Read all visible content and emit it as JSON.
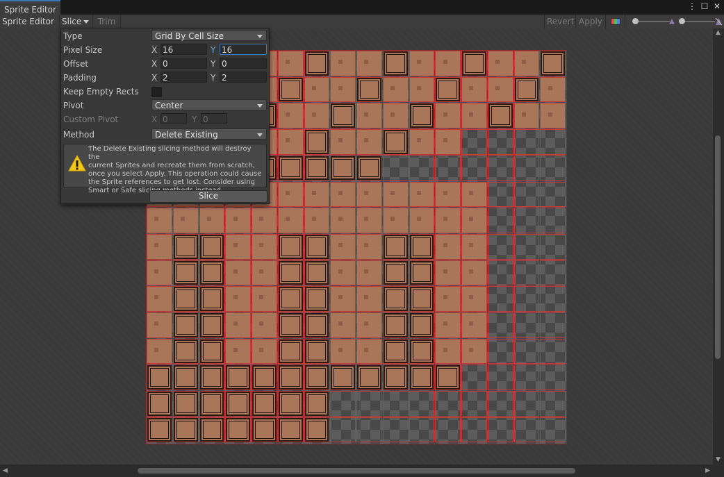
{
  "window": {
    "tab_title": "Sprite Editor"
  },
  "toolbar": {
    "mode_label": "Sprite Editor",
    "slice_label": "Slice",
    "trim_label": "Trim",
    "revert_label": "Revert",
    "apply_label": "Apply"
  },
  "slice_panel": {
    "type": {
      "label": "Type",
      "value": "Grid By Cell Size"
    },
    "pixel_size": {
      "label": "Pixel Size",
      "x": "16",
      "y": "16"
    },
    "offset": {
      "label": "Offset",
      "x": "0",
      "y": "0"
    },
    "padding": {
      "label": "Padding",
      "x": "2",
      "y": "2"
    },
    "keep_empty_rects": {
      "label": "Keep Empty Rects",
      "checked": false
    },
    "pivot": {
      "label": "Pivot",
      "value": "Center"
    },
    "custom_pivot": {
      "label": "Custom Pivot",
      "x": "0",
      "y": "0"
    },
    "method": {
      "label": "Method",
      "value": "Delete Existing"
    },
    "axis_x": "X",
    "axis_y": "Y",
    "warning_text": "The Delete Existing slicing method will destroy the\ncurrent Sprites and recreate them from scratch,\nonce you select Apply. This operation could cause\nthe Sprite references to get lost. Consider using\nSmart or Safe slicing methods instead.",
    "slice_button": "Slice"
  },
  "colors": {
    "accent": "#3a79bb",
    "slice_outline": "#c2383b",
    "tile_fill": "#a9765a",
    "warning": "#f5c518"
  }
}
